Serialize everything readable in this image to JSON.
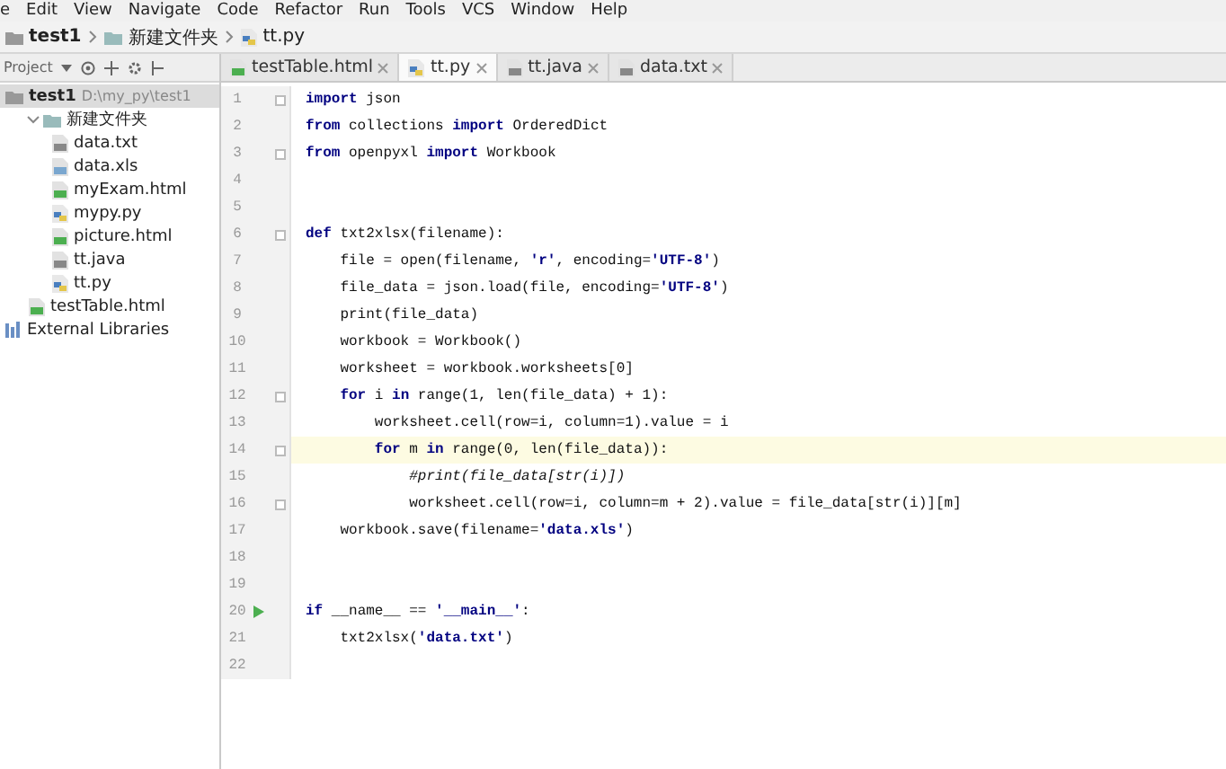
{
  "menu": [
    "e",
    "Edit",
    "View",
    "Navigate",
    "Code",
    "Refactor",
    "Run",
    "Tools",
    "VCS",
    "Window",
    "Help"
  ],
  "breadcrumb": [
    {
      "label": "test1",
      "kind": "project"
    },
    {
      "label": "新建文件夹",
      "kind": "folder"
    },
    {
      "label": "tt.py",
      "kind": "py"
    }
  ],
  "project_panel": {
    "title": "Project"
  },
  "tabs": [
    {
      "label": "testTable.html",
      "kind": "html",
      "selected": false
    },
    {
      "label": "tt.py",
      "kind": "py",
      "selected": true
    },
    {
      "label": "tt.java",
      "kind": "java",
      "selected": false
    },
    {
      "label": "data.txt",
      "kind": "txt",
      "selected": false
    }
  ],
  "tree": [
    {
      "label": "test1",
      "path": "D:\\my_py\\test1",
      "kind": "project",
      "selected": true,
      "children": [
        {
          "label": "新建文件夹",
          "kind": "folder",
          "expanded": true,
          "children": [
            {
              "label": "data.txt",
              "kind": "txt"
            },
            {
              "label": "data.xls",
              "kind": "xls"
            },
            {
              "label": "myExam.html",
              "kind": "html"
            },
            {
              "label": "mypy.py",
              "kind": "py"
            },
            {
              "label": "picture.html",
              "kind": "html"
            },
            {
              "label": "tt.java",
              "kind": "java"
            },
            {
              "label": "tt.py",
              "kind": "py"
            }
          ]
        },
        {
          "label": "testTable.html",
          "kind": "html"
        }
      ]
    },
    {
      "label": "External Libraries",
      "kind": "lib"
    }
  ],
  "code": [
    {
      "n": "1",
      "current": false,
      "fold": true,
      "run": false,
      "text": "**import** json"
    },
    {
      "n": "2",
      "current": false,
      "fold": false,
      "run": false,
      "text": "**from** collections **import** OrderedDict"
    },
    {
      "n": "3",
      "current": false,
      "fold": true,
      "run": false,
      "text": "**from** openpyxl **import** Workbook"
    },
    {
      "n": "4",
      "current": false,
      "fold": false,
      "run": false
    },
    {
      "n": "5",
      "current": false,
      "fold": false,
      "run": false
    },
    {
      "n": "6",
      "current": false,
      "fold": true,
      "run": false,
      "text": "**def** txt2xlsx(filename):"
    },
    {
      "n": "7",
      "current": false,
      "fold": false,
      "run": false,
      "text": "    file = open(filename, **'r'**, encoding=**'UTF-8'**)"
    },
    {
      "n": "8",
      "current": false,
      "fold": false,
      "run": false,
      "text": "    file_data = json.load(file, encoding=**'UTF-8'**)"
    },
    {
      "n": "9",
      "current": false,
      "fold": false,
      "run": false,
      "text": "    print(file_data)"
    },
    {
      "n": "10",
      "current": false,
      "fold": false,
      "run": false,
      "text": "    workbook = Workbook()"
    },
    {
      "n": "11",
      "current": false,
      "fold": false,
      "run": false,
      "text": "    worksheet = workbook.worksheets[0]"
    },
    {
      "n": "12",
      "current": false,
      "fold": true,
      "run": false,
      "text": "    **for** i **in** range(1, len(file_data) + 1):"
    },
    {
      "n": "13",
      "current": false,
      "fold": false,
      "run": false,
      "text": "        worksheet.cell(row=i, column=1).value = i"
    },
    {
      "n": "14",
      "current": true,
      "fold": true,
      "run": false,
      "text": "        **for** m **in** range(0, len(file_data)):"
    },
    {
      "n": "15",
      "current": false,
      "fold": false,
      "run": false,
      "text": "            *#print(file_data[str(i)])*"
    },
    {
      "n": "16",
      "current": false,
      "fold": true,
      "run": false,
      "text": "            worksheet.cell(row=i, column=m + 2).value = file_data[str(i)][m]"
    },
    {
      "n": "17",
      "current": false,
      "fold": false,
      "run": false,
      "text": "    workbook.save(filename=**'data.xls'**)"
    },
    {
      "n": "18",
      "current": false,
      "fold": false,
      "run": false
    },
    {
      "n": "19",
      "current": false,
      "fold": false,
      "run": false
    },
    {
      "n": "20",
      "current": false,
      "fold": false,
      "run": true,
      "text": "**if** __name__ == **'__main__'**:"
    },
    {
      "n": "21",
      "current": false,
      "fold": false,
      "run": false,
      "text": "    txt2xlsx(**'data.txt'**)"
    },
    {
      "n": "22",
      "current": false,
      "fold": false,
      "run": false
    }
  ]
}
